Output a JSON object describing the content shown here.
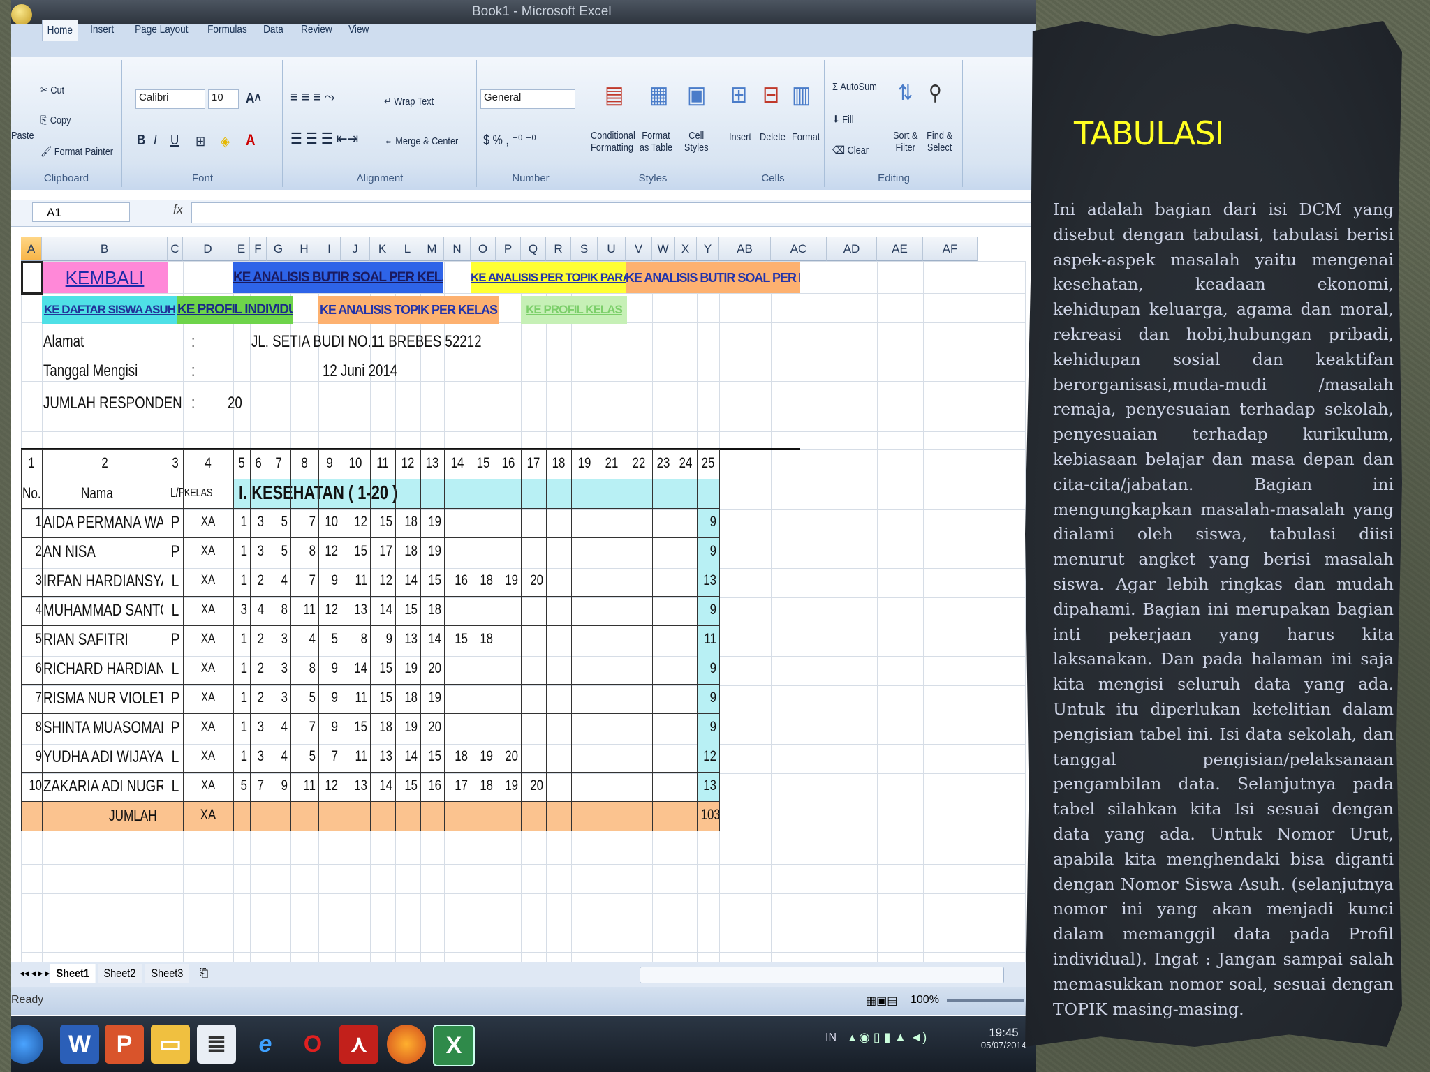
{
  "window_title": "Book1 - Microsoft Excel",
  "ribbon_tabs": [
    "Home",
    "Insert",
    "Page Layout",
    "Formulas",
    "Data",
    "Review",
    "View"
  ],
  "ribbon": {
    "clipboard": {
      "paste": "Paste",
      "cut": "Cut",
      "copy": "Copy",
      "format_painter": "Format Painter",
      "label": "Clipboard"
    },
    "font": {
      "name": "Calibri",
      "size": "10",
      "label": "Font"
    },
    "alignment": {
      "wrap": "Wrap Text",
      "merge": "Merge & Center",
      "label": "Alignment"
    },
    "number": {
      "format": "General",
      "label": "Number"
    },
    "styles": {
      "conditional": "Conditional Formatting",
      "format_table": "Format as Table",
      "cell_styles": "Cell Styles",
      "label": "Styles"
    },
    "cells": {
      "insert": "Insert",
      "delete": "Delete",
      "format": "Format",
      "label": "Cells"
    },
    "editing": {
      "autosum": "AutoSum",
      "fill": "Fill",
      "clear": "Clear",
      "sort": "Sort & Filter",
      "find": "Find & Select",
      "label": "Editing"
    }
  },
  "name_box": "A1",
  "fx": "fx",
  "columns": [
    "A",
    "B",
    "C",
    "D",
    "E",
    "F",
    "G",
    "H",
    "I",
    "J",
    "K",
    "L",
    "M",
    "N",
    "O",
    "P",
    "Q",
    "R",
    "S",
    "U",
    "V",
    "W",
    "X",
    "Y",
    "AB",
    "AC",
    "AD",
    "AE",
    "AF"
  ],
  "nav_buttons": {
    "kembali": "KEMBALI",
    "analisis_butir_1": "KE ANALISIS BUTIR SOAL PER KELAS",
    "analisis_topik_paralel": "KE ANALISIS PER TOPIK PARALEL",
    "analisis_butir_2": "KE ANALISIS  BUTIR SOAL PER KELAS",
    "daftar_siswa": "KE DAFTAR SISWA ASUH",
    "profil_individual": "KE PROFIL INDIVIDUAL",
    "analisis_topik_kelas": "KE ANALISIS TOPIK PER KELAS",
    "profil_kelas": "KE PROFIL KELAS"
  },
  "info": {
    "alamat_label": "Alamat",
    "alamat_value": "JL. SETIA BUDI NO.11 BREBES 52212",
    "tanggal_label": "Tanggal Mengisi",
    "tanggal_value": "12 Juni 2014",
    "jumlah_label": "JUMLAH RESPONDEN",
    "jumlah_value": "20",
    "colon": ":"
  },
  "table": {
    "number_row": [
      "1",
      "2",
      "3",
      "4",
      "5",
      "6",
      "7",
      "8",
      "9",
      "10",
      "11",
      "12",
      "13",
      "14",
      "15",
      "16",
      "17",
      "18",
      "19",
      "21",
      "22",
      "23",
      "24",
      "25"
    ],
    "header": {
      "no": "No.",
      "nama": "Nama",
      "lp": "L/P",
      "kelas": "KELAS",
      "section": "I. KESEHATAN ( 1-20 )"
    },
    "rows": [
      {
        "no": "1",
        "nama": "AIDA PERMANA WAT",
        "lp": "P",
        "kelas": "XA",
        "vals": [
          "1",
          "3",
          "5",
          "7",
          "10",
          "12",
          "15",
          "18",
          "19"
        ],
        "total": "9"
      },
      {
        "no": "2",
        "nama": "AN NISA",
        "lp": "P",
        "kelas": "XA",
        "vals": [
          "1",
          "3",
          "5",
          "8",
          "12",
          "15",
          "17",
          "18",
          "19"
        ],
        "total": "9"
      },
      {
        "no": "3",
        "nama": "IRFAN HARDIANSYAH",
        "lp": "L",
        "kelas": "XA",
        "vals": [
          "1",
          "2",
          "4",
          "7",
          "9",
          "11",
          "12",
          "14",
          "15",
          "16",
          "18",
          "19",
          "20"
        ],
        "total": "13"
      },
      {
        "no": "4",
        "nama": "MUHAMMAD SANTOS",
        "lp": "L",
        "kelas": "XA",
        "vals": [
          "3",
          "4",
          "8",
          "11",
          "12",
          "13",
          "14",
          "15",
          "18"
        ],
        "total": "9"
      },
      {
        "no": "5",
        "nama": "RIAN SAFITRI",
        "lp": "P",
        "kelas": "XA",
        "vals": [
          "1",
          "2",
          "3",
          "4",
          "5",
          "8",
          "9",
          "13",
          "14",
          "15",
          "18"
        ],
        "total": "11"
      },
      {
        "no": "6",
        "nama": "RICHARD HARDIANT(",
        "lp": "L",
        "kelas": "XA",
        "vals": [
          "1",
          "2",
          "3",
          "8",
          "9",
          "14",
          "15",
          "19",
          "20"
        ],
        "total": "9"
      },
      {
        "no": "7",
        "nama": "RISMA NUR VIOLETTA",
        "lp": "P",
        "kelas": "XA",
        "vals": [
          "1",
          "2",
          "3",
          "5",
          "9",
          "11",
          "15",
          "18",
          "19"
        ],
        "total": "9"
      },
      {
        "no": "8",
        "nama": "SHINTA MUASOMAH",
        "lp": "P",
        "kelas": "XA",
        "vals": [
          "1",
          "3",
          "4",
          "7",
          "9",
          "15",
          "18",
          "19",
          "20"
        ],
        "total": "9"
      },
      {
        "no": "9",
        "nama": "YUDHA ADI WIJAYA",
        "lp": "L",
        "kelas": "XA",
        "vals": [
          "1",
          "3",
          "4",
          "5",
          "7",
          "11",
          "13",
          "14",
          "15",
          "18",
          "19",
          "20"
        ],
        "total": "12"
      },
      {
        "no": "10",
        "nama": "ZAKARIA ADI NUGROI",
        "lp": "L",
        "kelas": "XA",
        "vals": [
          "5",
          "7",
          "9",
          "11",
          "12",
          "13",
          "14",
          "15",
          "16",
          "17",
          "18",
          "19",
          "20"
        ],
        "total": "13"
      }
    ],
    "jumlah_label": "JUMLAH",
    "jumlah_kelas": "XA",
    "jumlah_total": "103"
  },
  "sheet_tabs": [
    "Sheet1",
    "Sheet2",
    "Sheet3"
  ],
  "status": {
    "ready": "Ready",
    "zoom": "100%"
  },
  "taskbar": {
    "time": "19:45",
    "date": "05/07/2014",
    "lang": "IN"
  },
  "slide": {
    "title": "TABULASI",
    "body": "Ini adalah bagian dari isi DCM yang disebut dengan tabulasi, tabulasi berisi aspek-aspek masalah yaitu mengenai kesehatan, keadaan ekonomi, kehidupan keluarga, agama dan moral, rekreasi dan hobi,hubungan pribadi, kehidupan sosial dan keaktifan berorganisasi,muda-mudi /masalah remaja, penyesuaian terhadap sekolah, penyesuaian terhadap kurikulum, kebiasaan belajar dan masa depan dan cita-cita/jabatan. Bagian ini mengungkapkan masalah-masalah yang dialami oleh siswa, tabulasi diisi menurut angket yang berisi masalah siswa. Agar lebih ringkas dan mudah dipahami. Bagian ini merupakan bagian inti pekerjaan yang harus kita laksanakan. Dan pada halaman ini saja kita mengisi seluruh data yang ada. Untuk itu diperlukan ketelitian dalam pengisian tabel ini. Isi data sekolah, dan tanggal pengisian/pelaksanaan pengambilan data. Selanjutnya pada tabel silahkan kita Isi sesuai dengan data yang ada. Untuk Nomor Urut, apabila kita menghendaki bisa diganti dengan Nomor Siswa Asuh. (selanjutnya nomor ini yang akan menjadi kunci dalam memanggil data pada Profil individual). Ingat : Jangan sampai salah memasukkan nomor soal, sesuai dengan TOPIK masing-masing."
  },
  "colors": {
    "title": "#ffff22",
    "kembali_bg": "#ff88d8",
    "blue_btn": "#2e64e8",
    "yellow_btn": "#ffff33",
    "orange_btn": "#fdb170",
    "cyan_btn": "#4fe0e6",
    "green_btn": "#6ed44a",
    "light_green_btn": "#c6f0b6",
    "section_bg": "#b8f0f4",
    "jumlah_bg": "#fbc38f"
  }
}
